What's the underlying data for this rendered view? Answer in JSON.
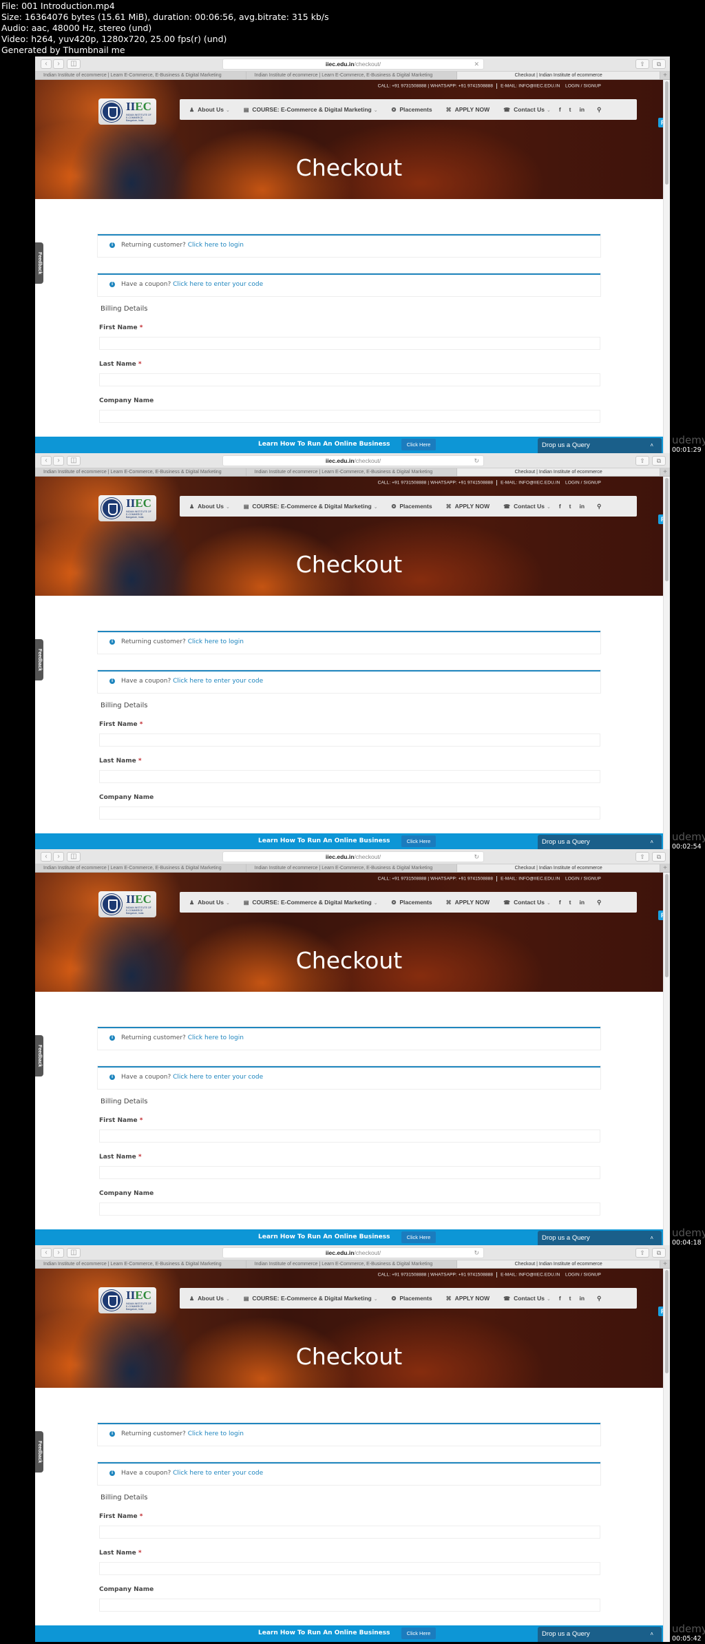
{
  "file_info": {
    "line1": "File: 001 Introduction.mp4",
    "line2": "Size: 16364076 bytes (15.61 MiB), duration: 00:06:56, avg.bitrate: 315 kb/s",
    "line3": "Audio: aac, 48000 Hz, stereo (und)",
    "line4": "Video: h264, yuv420p, 1280x720, 25.00 fps(r) (und)",
    "line5": "Generated by Thumbnail me"
  },
  "browser": {
    "url_domain": "iiec.edu.in",
    "url_path": "/checkout/",
    "tabs": [
      "Indian Institute of ecommerce | Learn E-Commerce, E-Business & Digital Marketing",
      "Indian Institute of ecommerce | Learn E-Commerce, E-Business & Digital Marketing",
      "Checkout | Indian Institute of ecommerce"
    ],
    "back_icon": "chevron-left-icon",
    "forward_icon": "chevron-right-icon",
    "sidebar_icon": "sidebar-icon",
    "share_icon": "share-icon",
    "tabs_icon": "tabs-icon",
    "new_tab": "+"
  },
  "site": {
    "topbar": {
      "phone": "CALL: +91 9731508888 | WHATSAPP: +91 9741508888",
      "email": "E-MAIL: INFO@IIEC.EDU.IN",
      "login": "LOGIN / SIGNUP"
    },
    "logo": {
      "brand_a": "II",
      "brand_b": "EC",
      "subtitle": "INDIAN INSTITUTE OF E-COMMERCE Bangalore, India"
    },
    "nav": [
      {
        "label": "About Us",
        "icon": "♟",
        "icon_name": "user-icon",
        "dropdown": true
      },
      {
        "label": "COURSE: E-Commerce & Digital Marketing",
        "icon": "▤",
        "icon_name": "book-icon",
        "dropdown": true
      },
      {
        "label": "Placements",
        "icon": "❂",
        "icon_name": "users-icon",
        "dropdown": false
      },
      {
        "label": "APPLY NOW",
        "icon": "⌘",
        "icon_name": "cart-icon",
        "dropdown": false
      },
      {
        "label": "Contact Us",
        "icon": "☎",
        "icon_name": "phone-icon",
        "dropdown": true
      }
    ],
    "social": {
      "facebook": "f",
      "twitter": "t",
      "linkedin": "in",
      "search": "⚲"
    },
    "hero_title": "Checkout",
    "feedback": "Feedback",
    "notices": {
      "returning_text": "Returning customer?",
      "returning_link": "Click here to login",
      "coupon_text": "Have a coupon?",
      "coupon_link": "Click here to enter your code",
      "info_icon": "i"
    },
    "billing": {
      "title": "Billing Details",
      "fields": [
        {
          "label": "First Name",
          "required": "*",
          "value": ""
        },
        {
          "label": "Last Name",
          "required": "*",
          "value": ""
        },
        {
          "label": "Company Name",
          "required": "",
          "value": ""
        }
      ]
    },
    "cta": {
      "text": "Learn How To Run An Online Business",
      "button": "Click Here"
    },
    "query": {
      "label": "Drop us a Query",
      "caret": "˄"
    },
    "float_badge": "P"
  },
  "frames": [
    {
      "timestamp": "00:01:29",
      "addr_icon": "✕",
      "watermark": "udemy"
    },
    {
      "timestamp": "00:02:54",
      "addr_icon": "↻",
      "watermark": "udemy"
    },
    {
      "timestamp": "00:04:18",
      "addr_icon": "↻",
      "watermark": "udemy"
    },
    {
      "timestamp": "00:05:42",
      "addr_icon": "↻",
      "watermark": "udemy"
    }
  ]
}
